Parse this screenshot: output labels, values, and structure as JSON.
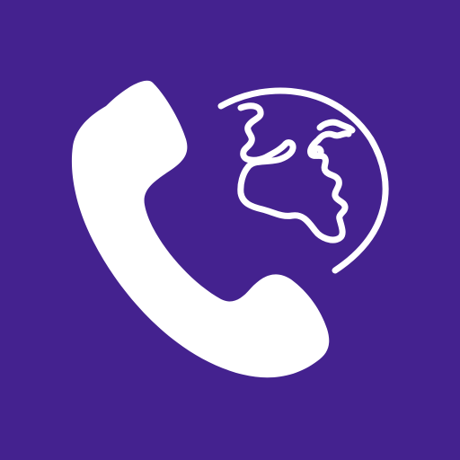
{
  "icon": {
    "name": "international-call",
    "background_color": "#44228f",
    "foreground_color": "#ffffff",
    "glyphs": [
      "phone-handset-icon",
      "globe-icon"
    ]
  }
}
